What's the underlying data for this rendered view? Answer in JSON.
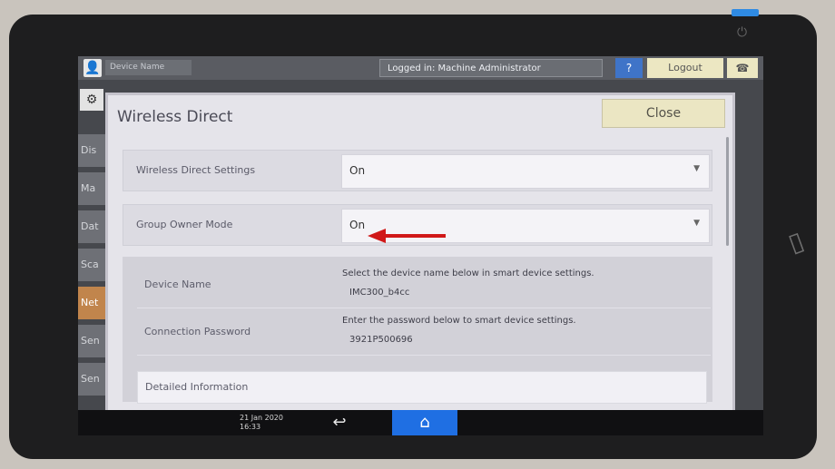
{
  "statusbar": {
    "device_name": "Device Name",
    "login_status": "Logged in: Machine Administrator",
    "help_label": "?",
    "logout_label": "Logout"
  },
  "background_menu": [
    "Dis",
    "Ma",
    "Dat",
    "Sca",
    "Net",
    "Sen",
    "Sen"
  ],
  "dialog": {
    "title": "Wireless Direct",
    "close_label": "Close",
    "wireless_direct_settings": {
      "label": "Wireless Direct Settings",
      "value": "On"
    },
    "group_owner_mode": {
      "label": "Group Owner Mode",
      "value": "On"
    },
    "device_name": {
      "label": "Device Name",
      "instruction": "Select the device name below in smart device settings.",
      "value": "IMC300_b4cc"
    },
    "connection_password": {
      "label": "Connection Password",
      "instruction": "Enter the password below to smart device settings.",
      "value": "3921P500696"
    },
    "detailed_information_label": "Detailed Information"
  },
  "bottombar": {
    "date": "21 Jan 2020",
    "time": "16:33"
  },
  "colors": {
    "annotation_arrow": "#d01818",
    "home_button": "#1f6fe3"
  },
  "icons": [
    "user-icon",
    "phone-icon",
    "back-icon",
    "home-icon",
    "power-icon",
    "nfc-icon",
    "chevron-down-icon"
  ]
}
